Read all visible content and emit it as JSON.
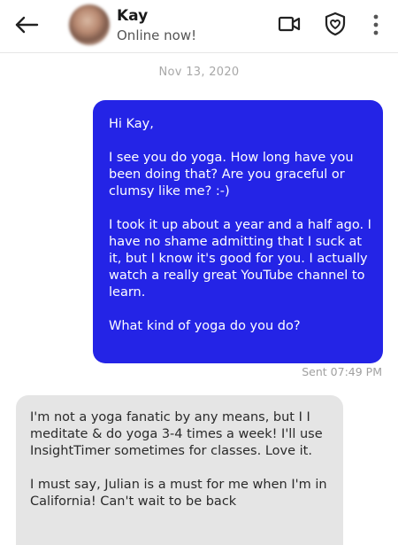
{
  "header": {
    "contact_name": "Kay",
    "status": "Online now!",
    "icons": {
      "back": "back-arrow-icon",
      "video": "video-call-icon",
      "safety": "shield-heart-icon",
      "more": "more-vertical-icon"
    }
  },
  "conversation": {
    "date": "Nov 13, 2020",
    "sent_message": {
      "paragraphs": [
        "Hi Kay,",
        "I see you do yoga. How long have you been doing that? Are you graceful or clumsy like me?  :-)",
        "I took it up about a year and a half ago. I have no shame admitting that I suck at it, but I know it's good for you. I actually watch a really great YouTube channel to learn.",
        "What kind of yoga do you do?"
      ],
      "status": "Sent 07:49 PM"
    },
    "received_message": {
      "paragraphs": [
        "I'm not a yoga fanatic by any means, but I I meditate & do yoga 3-4 times a week! I'll use InsightTimer sometimes for classes. Love it.",
        "I must say, Julian is a must for me when I'm in California! Can't wait to be back"
      ]
    }
  },
  "colors": {
    "sent_bubble": "#2424e6",
    "received_bubble": "#e5e5e5",
    "muted_text": "#a8a8a8"
  }
}
